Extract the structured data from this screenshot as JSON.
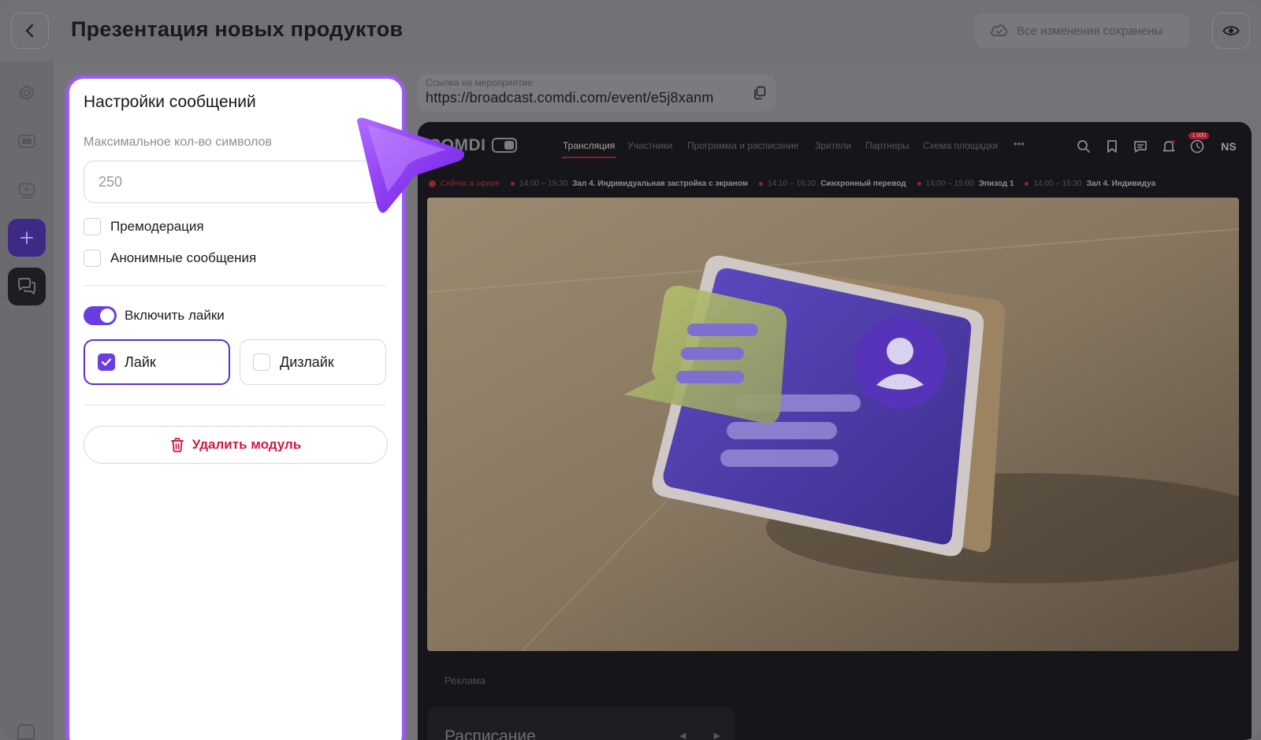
{
  "header": {
    "title": "Презентация новых продуктов",
    "save_status": "Все изменения сохранены"
  },
  "panel": {
    "title": "Настройки сообщений",
    "max_chars_label": "Максимальное кол-во символов",
    "max_chars_value": "250",
    "premoderation_label": "Премодерация",
    "premoderation_checked": false,
    "anonymous_label": "Анонимные сообщения",
    "anonymous_checked": false,
    "likes_toggle_label": "Включить лайки",
    "likes_enabled": true,
    "like_label": "Лайк",
    "like_checked": true,
    "dislike_label": "Дизлайк",
    "dislike_checked": false,
    "delete_label": "Удалить модуль"
  },
  "link": {
    "label": "Ссылка на мероприятие",
    "url": "https://broadcast.comdi.com/event/e5j8xanm"
  },
  "preview": {
    "logo": "COMDI",
    "tabs": [
      "Трансляция",
      "Участники",
      "Программа и расписание",
      "Зрители",
      "Партнеры",
      "Схема площадки"
    ],
    "more": "•••",
    "notification_badge": "1 000",
    "avatar": "NS",
    "live_label": "Сейчас в эфире",
    "ticker": [
      {
        "time": "14:00 – 15:30",
        "name": "Зал 4. Индивидуальная застройка с экраном"
      },
      {
        "time": "14:10 – 16:20",
        "name": "Синхронный перевод"
      },
      {
        "time": "14:00 – 15:00",
        "name": "Эпизод 1"
      },
      {
        "time": "14:00 – 15:30",
        "name": "Зал 4. Индивидуа"
      }
    ],
    "ad_label": "Реклама",
    "schedule_title": "Расписание",
    "schedule_arrows": "◀ ▶"
  },
  "colors": {
    "accent": "#6a3de0",
    "panel_border": "#9a5cf2",
    "danger": "#d01b3f",
    "live": "#8c2530"
  },
  "icons": {
    "back": "chevron-left-icon",
    "save_status": "cloud-check-icon",
    "preview": "eye-icon",
    "rail": [
      "gear-icon",
      "screen-icon",
      "play-icon",
      "plus-icon",
      "chat-icon"
    ],
    "delete": "trash-icon",
    "copy": "copy-icon"
  }
}
